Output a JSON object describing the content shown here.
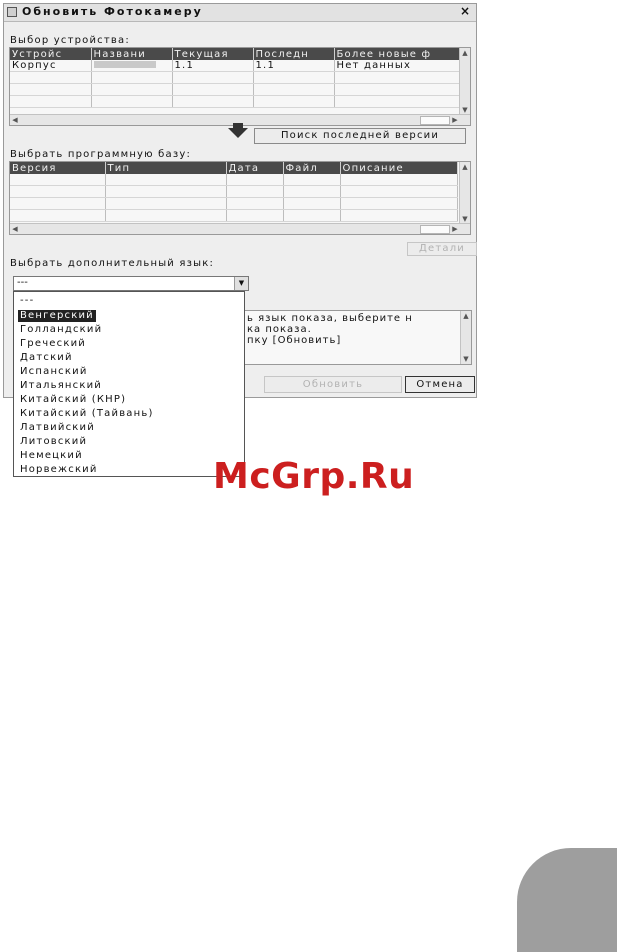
{
  "window": {
    "title": "Обновить Фотокамеру",
    "close": "×"
  },
  "device_section": {
    "label": "Выбор устройства:",
    "columns": [
      "Устройс",
      "Названи",
      "Текущая",
      "Последн",
      "Более новые ф"
    ],
    "rows": [
      [
        "Корпус",
        "",
        "1.1",
        "1.1",
        "Нет данных"
      ]
    ]
  },
  "search_button": "Поиск последней версии",
  "firmware_section": {
    "label": "Выбрать программную базу:",
    "columns": [
      "Версия",
      "Тип",
      "Дата",
      "Файл",
      "Описание"
    ]
  },
  "details_button": "Детали",
  "language": {
    "label": "Выбрать дополнительный язык:",
    "selected": "---",
    "options": [
      "---",
      "Венгерский",
      "Голландский",
      "Греческий",
      "Датский",
      "Испанский",
      "Итальянский",
      "Китайский (КНР)",
      "Китайский (Тайвань)",
      "Латвийский",
      "Литовский",
      "Немецкий",
      "Норвежский"
    ],
    "highlighted_index": 1
  },
  "info_text": [
    "ь язык показа, выберите н",
    "ка показа.",
    "пку [Обновить]"
  ],
  "update_button": "Обновить",
  "cancel_button": "Отмена",
  "watermark": "McGrp.Ru",
  "colors": {
    "header": "#4a4a4a",
    "watermark": "#cc1f1f",
    "tab": "#9e9e9e"
  }
}
